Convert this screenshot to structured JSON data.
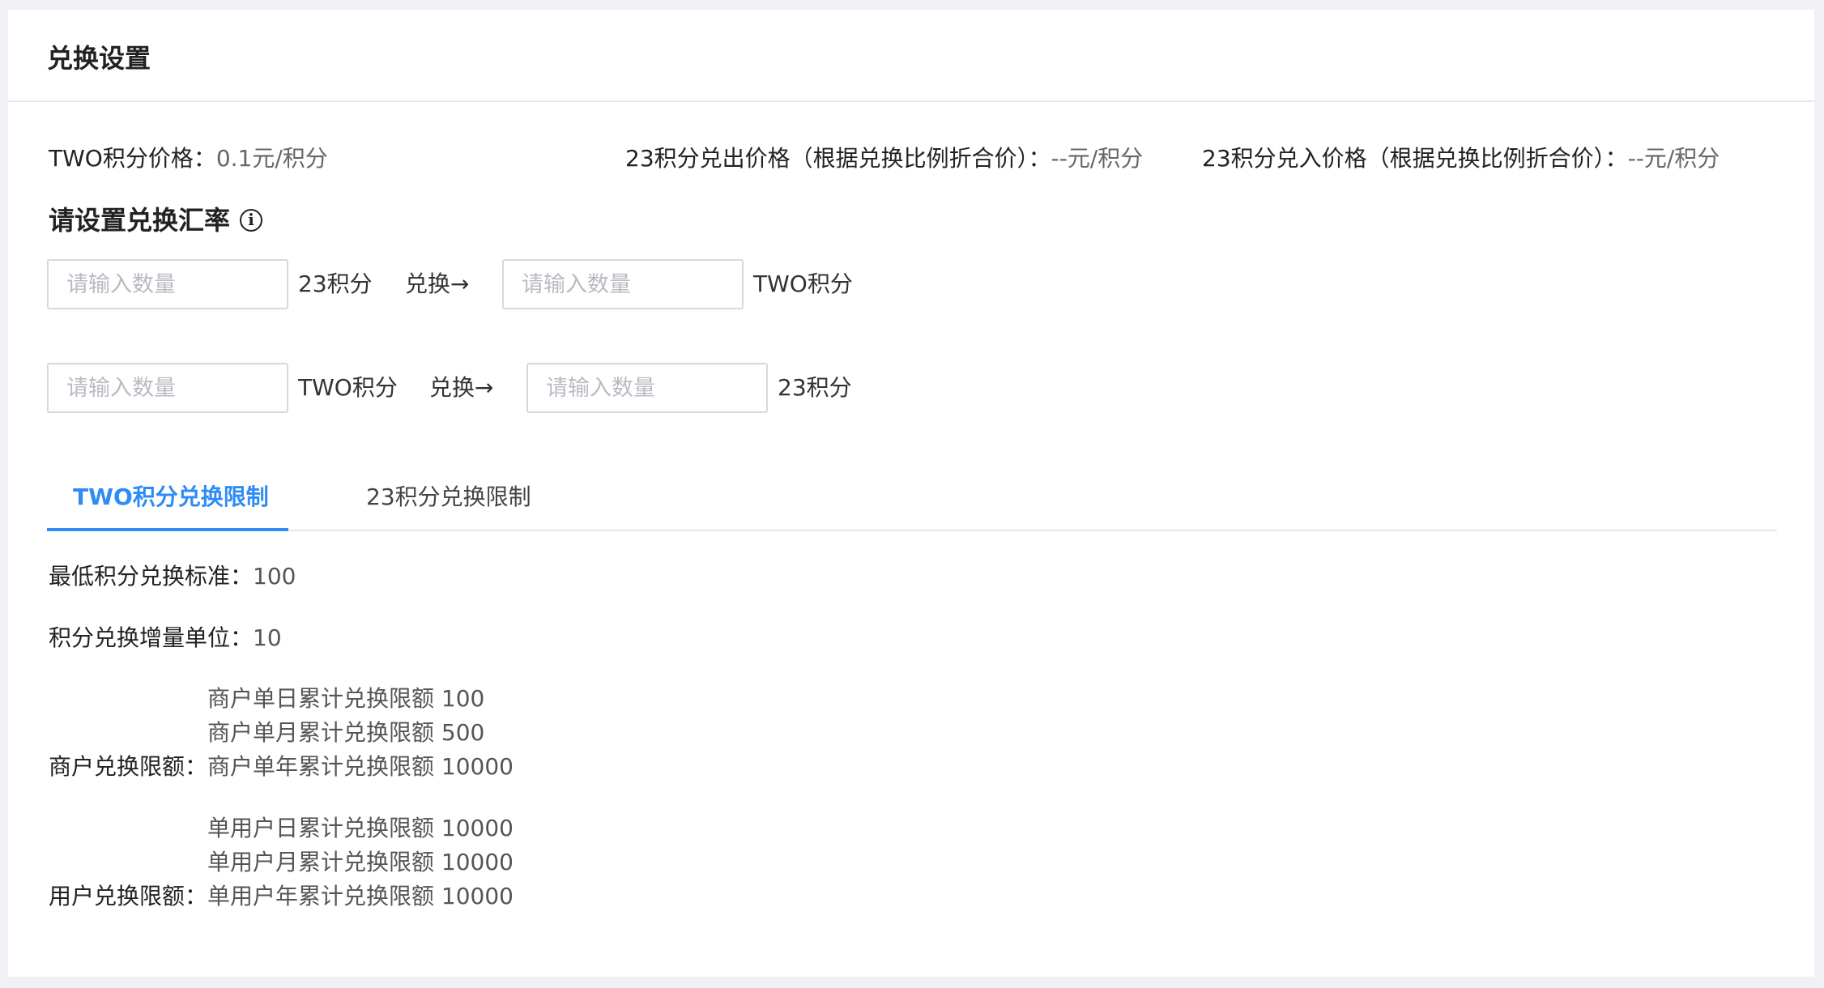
{
  "header": {
    "title": "兑换设置"
  },
  "prices": {
    "two_price_label": "TWO积分价格：",
    "two_price_value": "0.1元/积分",
    "out_price_label": "23积分兑出价格（根据兑换比例折合价）：",
    "out_price_value": "--元/积分",
    "in_price_label": "23积分兑入价格（根据兑换比例折合价）：",
    "in_price_value": "--元/积分"
  },
  "rate_section": {
    "title": "请设置兑换汇率",
    "icon": "info-icon",
    "rows": [
      {
        "from_placeholder": "请输入数量",
        "from_unit": "23积分",
        "arrow_label": "兑换→",
        "to_placeholder": "请输入数量",
        "to_unit": "TWO积分"
      },
      {
        "from_placeholder": "请输入数量",
        "from_unit": "TWO积分",
        "arrow_label": "兑换→",
        "to_placeholder": "请输入数量",
        "to_unit": "23积分"
      }
    ]
  },
  "tabs": [
    {
      "label": "TWO积分兑换限制",
      "active": true
    },
    {
      "label": "23积分兑换限制",
      "active": false
    }
  ],
  "limits": {
    "min_standard_label": "最低积分兑换标准：",
    "min_standard_value": "100",
    "increment_label": "积分兑换增量单位：",
    "increment_value": "10",
    "merchant_label": "商户兑换限额：",
    "merchant_lines": [
      "商户单日累计兑换限额 100",
      "商户单月累计兑换限额 500",
      "商户单年累计兑换限额 10000"
    ],
    "user_label": "用户兑换限额：",
    "user_lines": [
      "单用户日累计兑换限额 10000",
      "单用户月累计兑换限额 10000",
      "单用户年累计兑换限额 10000"
    ]
  },
  "colors": {
    "accent": "#2f8cf5",
    "page_background": "#f0f1f5",
    "card_background": "#ffffff"
  }
}
